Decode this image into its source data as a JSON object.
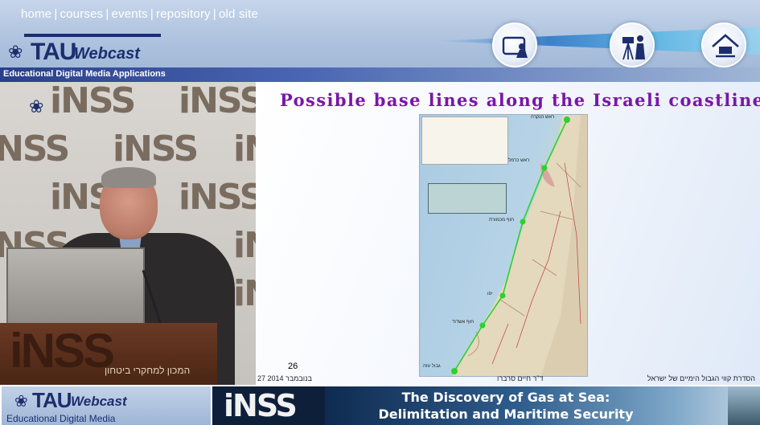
{
  "nav": {
    "items": [
      "home",
      "courses",
      "events",
      "repository",
      "old site"
    ],
    "separator": "|"
  },
  "brand": {
    "logo_tau": "TAU",
    "logo_webcast": "Webcast",
    "tagline": "Educational Digital Media Applications",
    "colors": {
      "navy": "#1d2e6e",
      "header_bg": "#a9bfdc"
    }
  },
  "header_icons": [
    "presenter-screen-icon",
    "video-camera-icon",
    "laptop-home-icon"
  ],
  "video": {
    "backdrop_logo": "iNSS",
    "podium_logo": "iNSS",
    "podium_subtitle": "המכון למחקרי ביטחון"
  },
  "slide": {
    "title": "Possible base lines along the Israeli coastline",
    "page_number": "26",
    "footer_left": "27 בנובמבר 2014",
    "footer_center": "ד\"ר חיים סרברו",
    "footer_right": "הסדרת קווי הגבול הימיים של ישראל",
    "map_labels": [
      "ראש הנקרה",
      "ראש כרמל",
      "חוף מכמורת",
      "יפו",
      "חוף אשדוד",
      "גבול עזה"
    ],
    "colors": {
      "title": "#7a16a8",
      "baseline": "#2dd12d"
    }
  },
  "banner": {
    "logo_tau": "TAU",
    "logo_webcast": "Webcast",
    "logo_sub": "Educational Digital Media",
    "inss": "iNSS",
    "title_line1": "The Discovery of Gas at Sea:",
    "title_line2": "Delimitation and Maritime Security"
  }
}
